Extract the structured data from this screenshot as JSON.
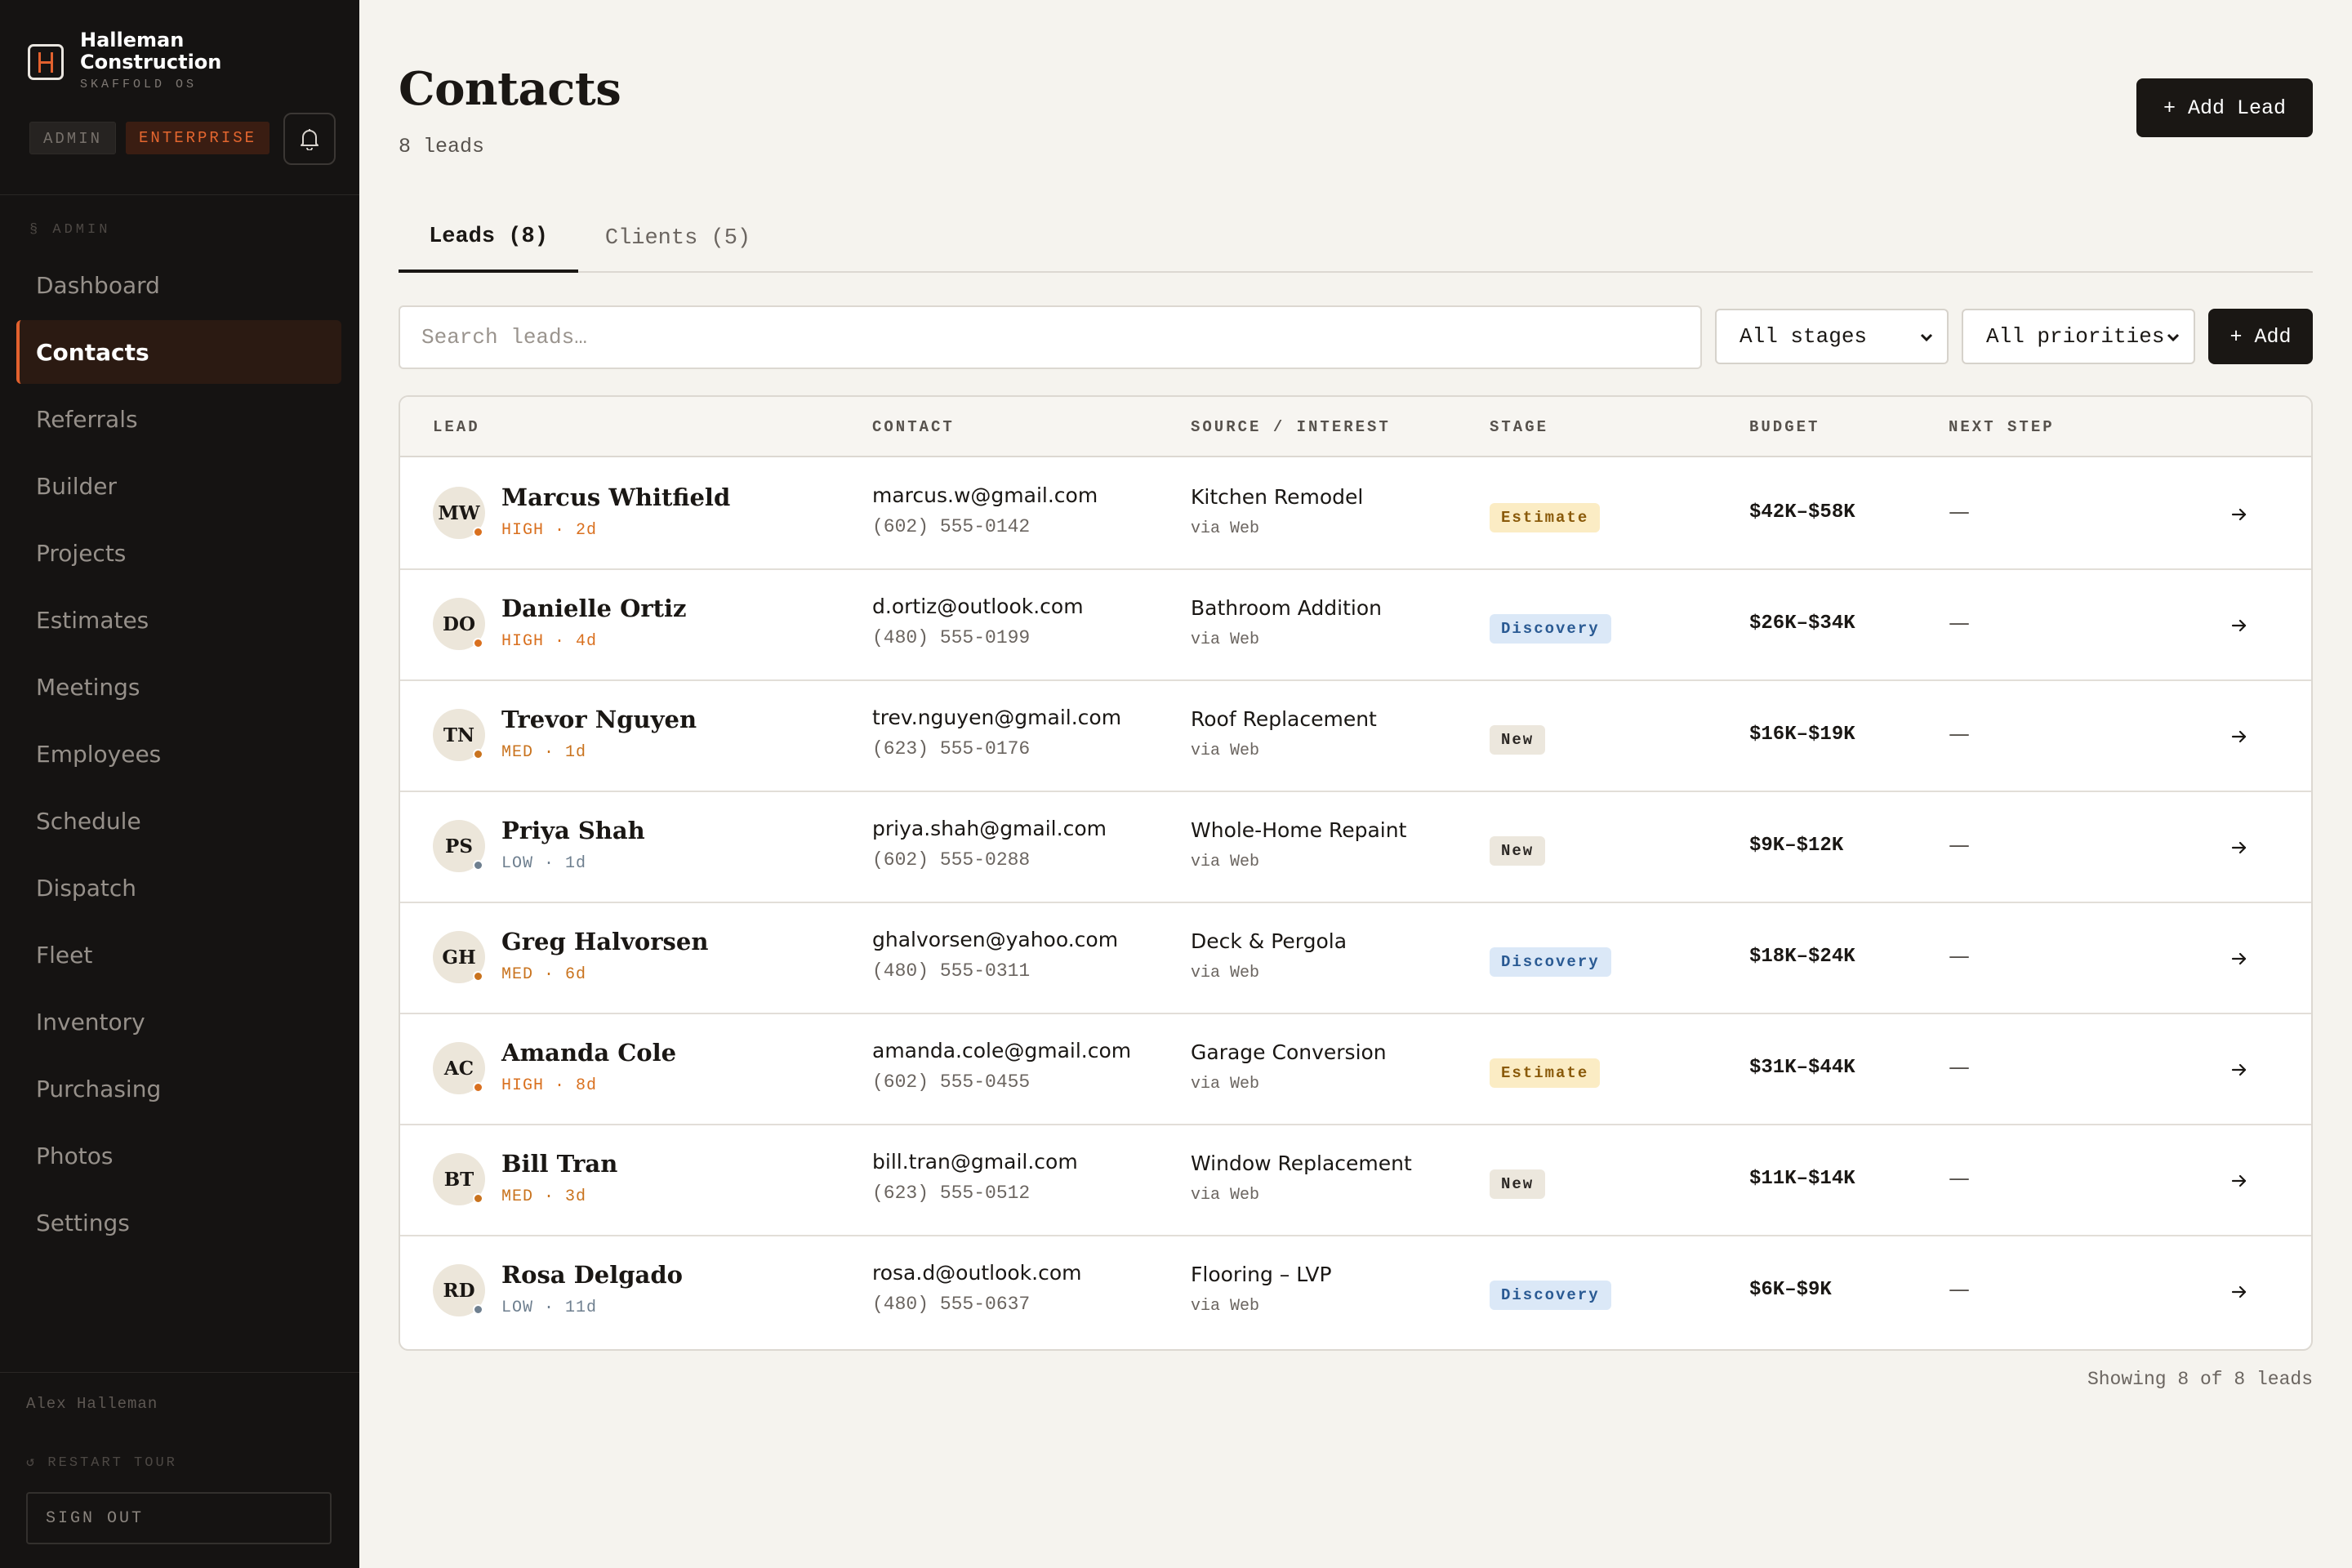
{
  "brand": {
    "name_line1": "Halleman",
    "name_line2": "Construction",
    "subtitle": "SKAFFOLD OS"
  },
  "badges": {
    "role": "ADMIN",
    "plan": "ENTERPRISE"
  },
  "sidebar": {
    "section_label": "§ ADMIN",
    "items": [
      {
        "label": "Dashboard",
        "active": false
      },
      {
        "label": "Contacts",
        "active": true
      },
      {
        "label": "Referrals",
        "active": false
      },
      {
        "label": "Builder",
        "active": false
      },
      {
        "label": "Projects",
        "active": false
      },
      {
        "label": "Estimates",
        "active": false
      },
      {
        "label": "Meetings",
        "active": false
      },
      {
        "label": "Employees",
        "active": false
      },
      {
        "label": "Schedule",
        "active": false
      },
      {
        "label": "Dispatch",
        "active": false
      },
      {
        "label": "Fleet",
        "active": false
      },
      {
        "label": "Inventory",
        "active": false
      },
      {
        "label": "Purchasing",
        "active": false
      },
      {
        "label": "Photos",
        "active": false
      },
      {
        "label": "Settings",
        "active": false
      }
    ],
    "user_name": "Alex Halleman",
    "restart_tour": "↺ RESTART TOUR",
    "sign_out": "SIGN OUT"
  },
  "header": {
    "title": "Contacts",
    "count_label": "8 leads",
    "add_lead_label": "+ Add Lead"
  },
  "tabs": [
    {
      "label": "Leads (8)",
      "active": true
    },
    {
      "label": "Clients (5)",
      "active": false
    }
  ],
  "filters": {
    "search_placeholder": "Search leads…",
    "stage_selected": "All stages",
    "priority_selected": "All priorities",
    "add_label": "+ Add"
  },
  "table": {
    "columns": [
      "LEAD",
      "CONTACT",
      "SOURCE / INTEREST",
      "STAGE",
      "BUDGET",
      "NEXT STEP"
    ],
    "rows": [
      {
        "initials": "MW",
        "name": "Marcus Whitfield",
        "meta": "HIGH · 2d",
        "priority": "high",
        "email": "marcus.w@gmail.com",
        "phone": "(602) 555-0142",
        "interest": "Kitchen Remodel",
        "source": "via Web",
        "stage": "Estimate",
        "budget": "$42K–$58K",
        "next_step": "—"
      },
      {
        "initials": "DO",
        "name": "Danielle Ortiz",
        "meta": "HIGH · 4d",
        "priority": "high",
        "email": "d.ortiz@outlook.com",
        "phone": "(480) 555-0199",
        "interest": "Bathroom Addition",
        "source": "via Web",
        "stage": "Discovery",
        "budget": "$26K–$34K",
        "next_step": "—"
      },
      {
        "initials": "TN",
        "name": "Trevor Nguyen",
        "meta": "MED · 1d",
        "priority": "med",
        "email": "trev.nguyen@gmail.com",
        "phone": "(623) 555-0176",
        "interest": "Roof Replacement",
        "source": "via Web",
        "stage": "New",
        "budget": "$16K–$19K",
        "next_step": "—"
      },
      {
        "initials": "PS",
        "name": "Priya Shah",
        "meta": "LOW · 1d",
        "priority": "low",
        "email": "priya.shah@gmail.com",
        "phone": "(602) 555-0288",
        "interest": "Whole-Home Repaint",
        "source": "via Web",
        "stage": "New",
        "budget": "$9K–$12K",
        "next_step": "—"
      },
      {
        "initials": "GH",
        "name": "Greg Halvorsen",
        "meta": "MED · 6d",
        "priority": "med",
        "email": "ghalvorsen@yahoo.com",
        "phone": "(480) 555-0311",
        "interest": "Deck & Pergola",
        "source": "via Web",
        "stage": "Discovery",
        "budget": "$18K–$24K",
        "next_step": "—"
      },
      {
        "initials": "AC",
        "name": "Amanda Cole",
        "meta": "HIGH · 8d",
        "priority": "high",
        "email": "amanda.cole@gmail.com",
        "phone": "(602) 555-0455",
        "interest": "Garage Conversion",
        "source": "via Web",
        "stage": "Estimate",
        "budget": "$31K–$44K",
        "next_step": "—"
      },
      {
        "initials": "BT",
        "name": "Bill Tran",
        "meta": "MED · 3d",
        "priority": "med",
        "email": "bill.tran@gmail.com",
        "phone": "(623) 555-0512",
        "interest": "Window Replacement",
        "source": "via Web",
        "stage": "New",
        "budget": "$11K–$14K",
        "next_step": "—"
      },
      {
        "initials": "RD",
        "name": "Rosa Delgado",
        "meta": "LOW · 11d",
        "priority": "low",
        "email": "rosa.d@outlook.com",
        "phone": "(480) 555-0637",
        "interest": "Flooring – LVP",
        "source": "via Web",
        "stage": "Discovery",
        "budget": "$6K–$9K",
        "next_step": "—"
      }
    ]
  },
  "footer": {
    "showing_label": "Showing 8 of 8 leads"
  },
  "colors": {
    "accent": "#e2612e",
    "sidebar_bg": "#151312",
    "page_bg": "#f5f3ee",
    "priority_high": "#d9701f",
    "priority_med": "#c9731e",
    "priority_low": "#6e7f8f",
    "stage_estimate_bg": "#fbecc4",
    "stage_estimate_fg": "#8a5a0a",
    "stage_discovery_bg": "#dbe8f7",
    "stage_discovery_fg": "#2a5a93",
    "stage_new_bg": "#ece7dd",
    "stage_new_fg": "#2b2724"
  },
  "icons": {
    "bell": "bell-icon",
    "row_action": "arrow-right-icon",
    "select": "chevron-down-icon",
    "logo": "h-logo-icon"
  }
}
